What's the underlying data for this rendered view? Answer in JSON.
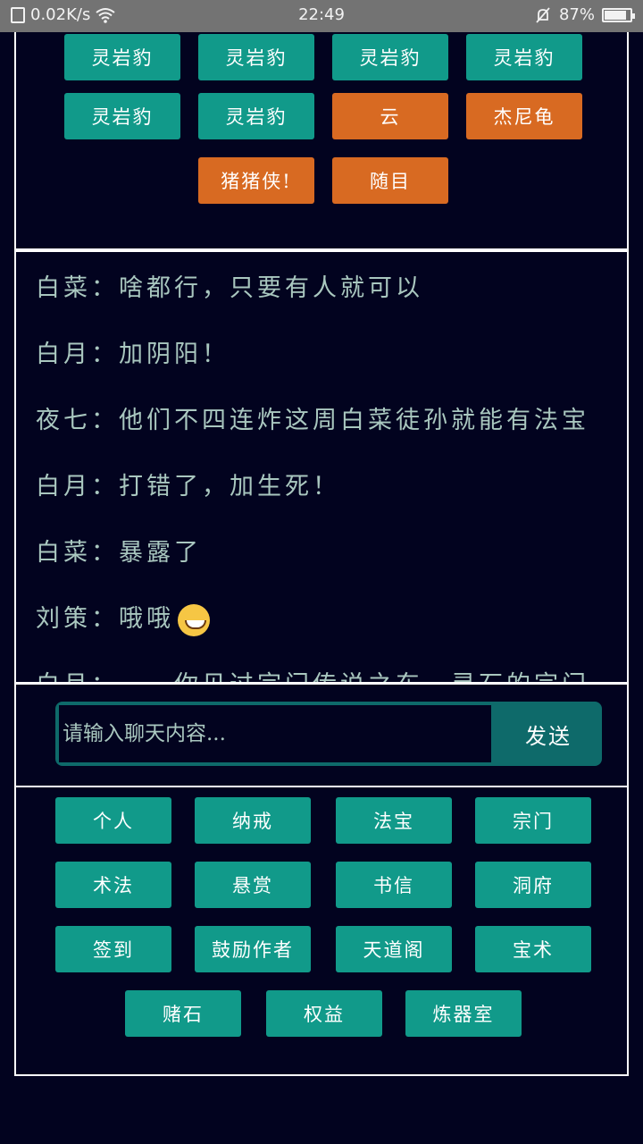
{
  "status_bar": {
    "net_speed": "0.02K/s",
    "time": "22:49",
    "battery": "87%",
    "battery_level": 0.87
  },
  "top_buttons": [
    {
      "label": "灵岩豹",
      "color": "teal"
    },
    {
      "label": "灵岩豹",
      "color": "teal"
    },
    {
      "label": "灵岩豹",
      "color": "teal"
    },
    {
      "label": "灵岩豹",
      "color": "teal"
    },
    {
      "label": "灵岩豹",
      "color": "teal"
    },
    {
      "label": "灵岩豹",
      "color": "teal"
    },
    {
      "label": "云",
      "color": "orange"
    },
    {
      "label": "杰尼龟",
      "color": "orange"
    },
    {
      "label": "猪猪侠!",
      "color": "orange"
    },
    {
      "label": "随目",
      "color": "orange"
    }
  ],
  "chat": [
    {
      "text": "白菜：啥都行，只要有人就可以"
    },
    {
      "text": "白月：加阴阳！"
    },
    {
      "text": "夜七：他们不四连炸这周白菜徒孙就能有法宝"
    },
    {
      "text": "白月：打错了，加生死！"
    },
    {
      "text": "白菜：暴露了"
    },
    {
      "text": "刘策：哦哦"
    },
    {
      "text": "白月：……你见过宗门传说之东一灵石的宗门"
    }
  ],
  "input": {
    "placeholder": "请输入聊天内容...",
    "send_label": "发送"
  },
  "menu": [
    "个人",
    "纳戒",
    "法宝",
    "宗门",
    "术法",
    "悬赏",
    "书信",
    "洞府",
    "签到",
    "鼓励作者",
    "天道阁",
    "宝术",
    "赌石",
    "权益",
    "炼器室"
  ]
}
